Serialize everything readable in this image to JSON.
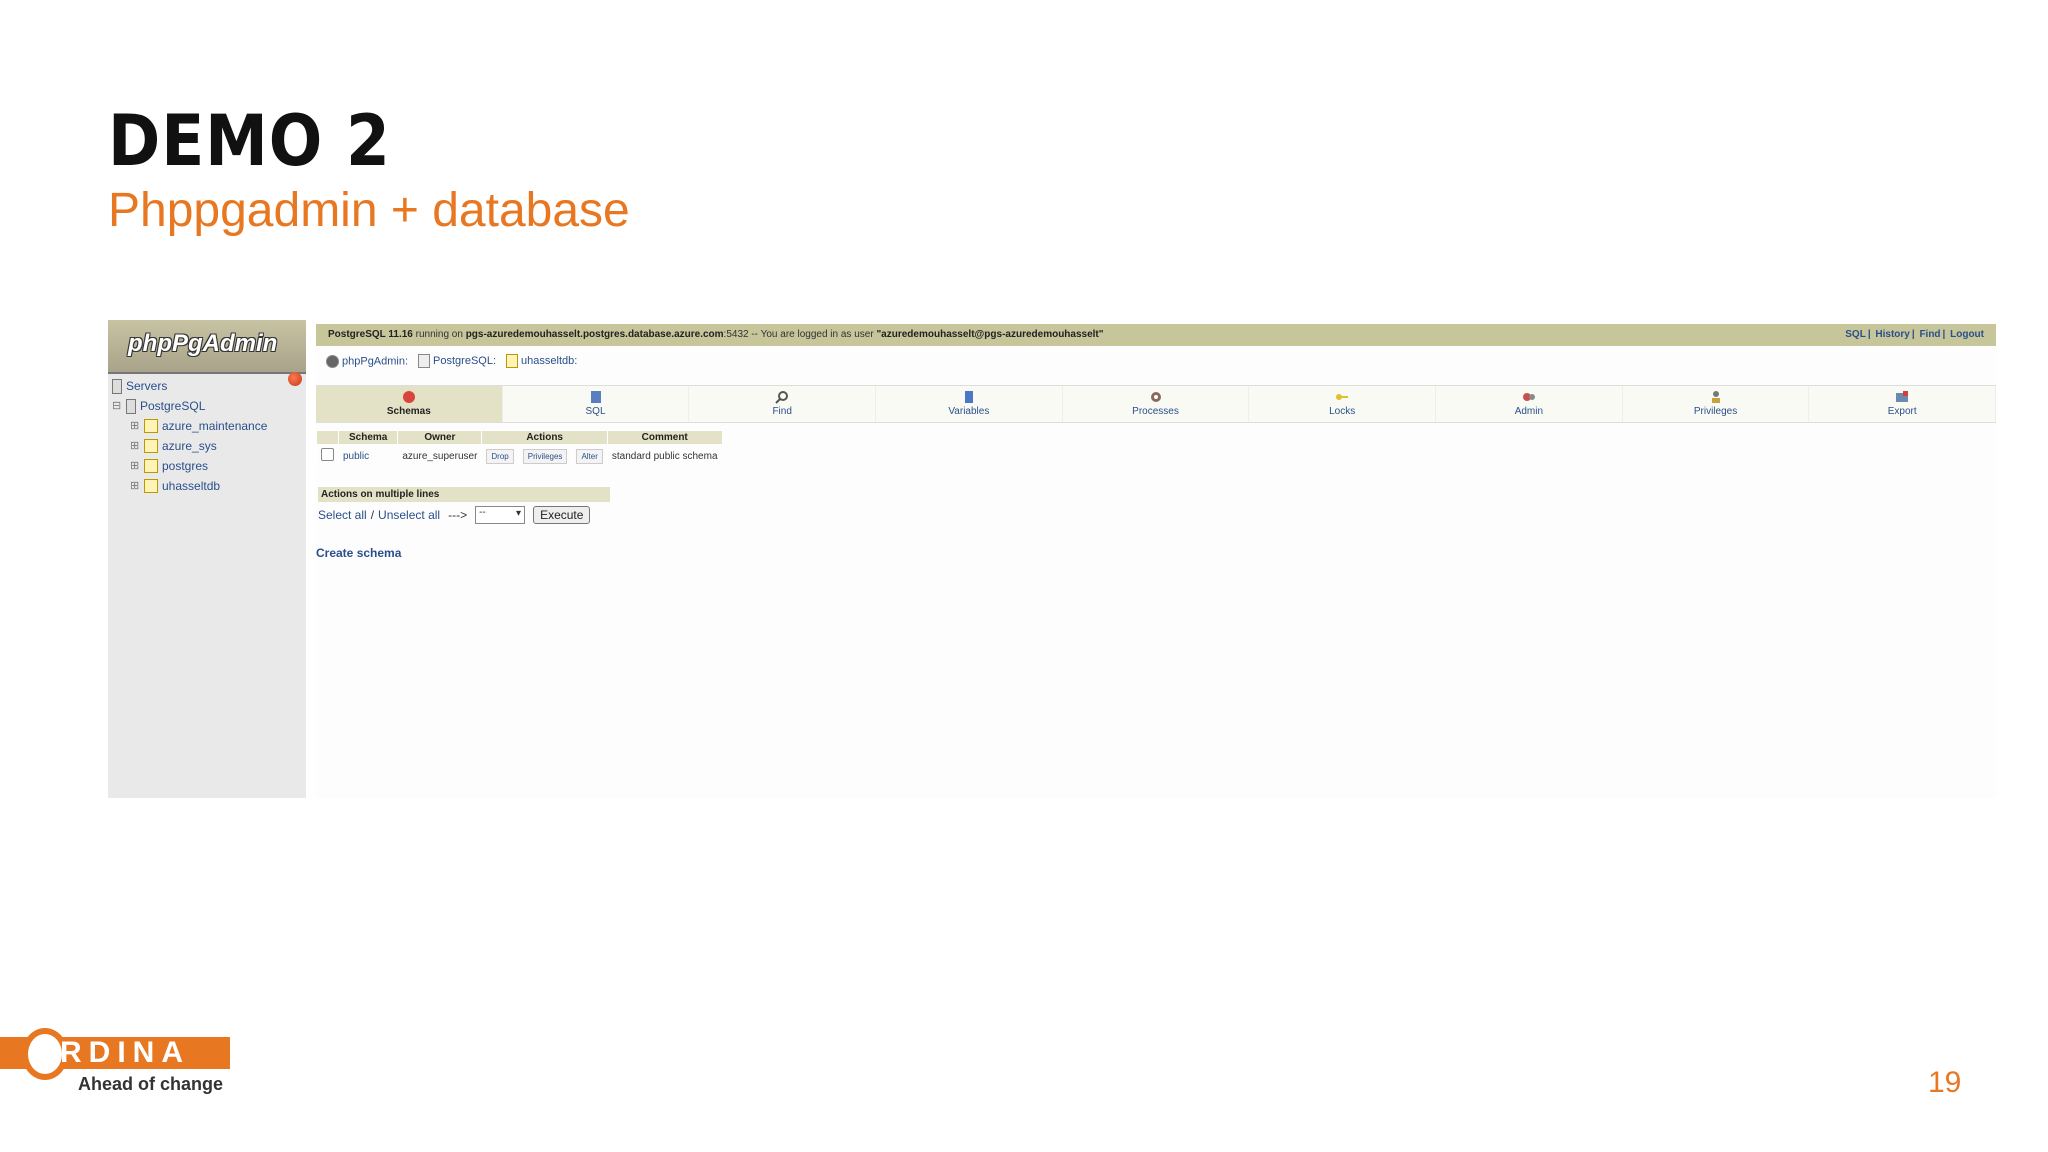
{
  "slide": {
    "title": "DEMO 2",
    "subtitle": "Phppgadmin + database",
    "page_number": "19",
    "logo": {
      "word": "RDINA",
      "tagline": "Ahead of change"
    }
  },
  "app": {
    "logo_text": "phpPgAdmin",
    "tree": [
      {
        "label": "Servers",
        "level": 0
      },
      {
        "label": "PostgreSQL",
        "level": 1
      },
      {
        "label": "azure_maintenance",
        "level": 2
      },
      {
        "label": "azure_sys",
        "level": 2
      },
      {
        "label": "postgres",
        "level": 2
      },
      {
        "label": "uhasseltdb",
        "level": 2
      }
    ],
    "topbar": {
      "version": "PostgreSQL 11.16",
      "running_on": "running on",
      "host": "pgs-azuredemouhasselt.postgres.database.azure.com",
      "port_text": ":5432 -- You are logged in as user",
      "user": "\"azuredemouhasselt@pgs-azuredemouhasselt\"",
      "links": [
        "SQL",
        "History",
        "Find",
        "Logout"
      ]
    },
    "breadcrumb": [
      "phpPgAdmin:",
      "PostgreSQL:",
      "uhasseltdb:"
    ],
    "tabs": [
      "Schemas",
      "SQL",
      "Find",
      "Variables",
      "Processes",
      "Locks",
      "Admin",
      "Privileges",
      "Export"
    ],
    "table": {
      "headers": [
        "Schema",
        "Owner",
        "Actions",
        "Comment"
      ],
      "row": {
        "schema": "public",
        "owner": "azure_superuser",
        "actions": [
          "Drop",
          "Privileges",
          "Alter"
        ],
        "comment": "standard public schema"
      }
    },
    "multi": {
      "header": "Actions on multiple lines",
      "select_all": "Select all",
      "sep": "/",
      "unselect_all": "Unselect all",
      "arrow": "--->",
      "select_value": "--",
      "execute": "Execute"
    },
    "create_schema": "Create schema"
  }
}
